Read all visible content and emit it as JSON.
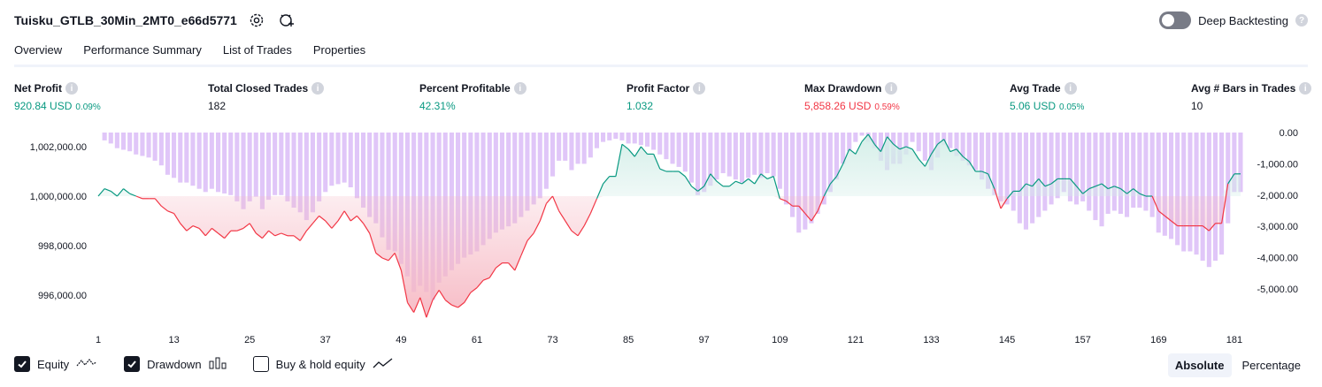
{
  "header": {
    "title": "Tuisku_GTLB_30Min_2MT0_e66d5771",
    "icons": [
      "settings-gear-icon",
      "add-to-chart-icon"
    ],
    "deep_backtesting_label": "Deep Backtesting",
    "deep_backtesting_on": false,
    "help_icon": "?"
  },
  "tabs": [
    {
      "label": "Overview",
      "active": true
    },
    {
      "label": "Performance Summary",
      "active": false
    },
    {
      "label": "List of Trades",
      "active": false
    },
    {
      "label": "Properties",
      "active": false
    }
  ],
  "metrics": [
    {
      "label": "Net Profit",
      "value": "920.84 USD",
      "pct": "0.09%",
      "color": "#089981"
    },
    {
      "label": "Total Closed Trades",
      "value": "182",
      "pct": "",
      "color": "#131722"
    },
    {
      "label": "Percent Profitable",
      "value": "42.31%",
      "pct": "",
      "color": "#089981"
    },
    {
      "label": "Profit Factor",
      "value": "1.032",
      "pct": "",
      "color": "#089981"
    },
    {
      "label": "Max Drawdown",
      "value": "5,858.26 USD",
      "pct": "0.59%",
      "color": "#f23645"
    },
    {
      "label": "Avg Trade",
      "value": "5.06 USD",
      "pct": "0.05%",
      "color": "#089981"
    },
    {
      "label": "Avg # Bars in Trades",
      "value": "10",
      "pct": "",
      "color": "#131722"
    }
  ],
  "info_glyph": "i",
  "chart_data": {
    "type": "line",
    "left_axis_ticks": [
      "1,002,000.00",
      "1,000,000.00",
      "998,000.00",
      "996,000.00"
    ],
    "left_axis_values": [
      1002000,
      1000000,
      998000,
      996000
    ],
    "right_axis_ticks": [
      "0.00",
      "-1,000.00",
      "-2,000.00",
      "-3,000.00",
      "-4,000.00",
      "-5,000.00"
    ],
    "right_axis_values": [
      0,
      -1000,
      -2000,
      -3000,
      -4000,
      -5000
    ],
    "x_ticks": [
      "1",
      "13",
      "25",
      "37",
      "49",
      "61",
      "73",
      "85",
      "97",
      "109",
      "121",
      "133",
      "145",
      "157",
      "169",
      "181"
    ],
    "initial_capital": 1000000,
    "equity_series": [
      [
        1,
        1000000
      ],
      [
        2,
        1000300
      ],
      [
        3,
        1000200
      ],
      [
        4,
        1000000
      ],
      [
        5,
        1000300
      ],
      [
        6,
        1000100
      ],
      [
        7,
        1000000
      ],
      [
        8,
        999900
      ],
      [
        9,
        999900
      ],
      [
        10,
        999900
      ],
      [
        11,
        999600
      ],
      [
        12,
        999400
      ],
      [
        13,
        999300
      ],
      [
        14,
        998900
      ],
      [
        15,
        998600
      ],
      [
        16,
        998800
      ],
      [
        17,
        998700
      ],
      [
        18,
        998400
      ],
      [
        19,
        998700
      ],
      [
        20,
        998500
      ],
      [
        21,
        998300
      ],
      [
        22,
        998600
      ],
      [
        23,
        998600
      ],
      [
        24,
        998700
      ],
      [
        25,
        998900
      ],
      [
        26,
        998500
      ],
      [
        27,
        998300
      ],
      [
        28,
        998600
      ],
      [
        29,
        998400
      ],
      [
        30,
        998500
      ],
      [
        31,
        998400
      ],
      [
        32,
        998400
      ],
      [
        33,
        998200
      ],
      [
        34,
        998600
      ],
      [
        35,
        998900
      ],
      [
        36,
        999200
      ],
      [
        37,
        999000
      ],
      [
        38,
        998700
      ],
      [
        39,
        999000
      ],
      [
        40,
        999400
      ],
      [
        41,
        999000
      ],
      [
        42,
        999200
      ],
      [
        43,
        998900
      ],
      [
        44,
        998500
      ],
      [
        45,
        997700
      ],
      [
        46,
        997500
      ],
      [
        47,
        997400
      ],
      [
        48,
        997700
      ],
      [
        49,
        997000
      ],
      [
        50,
        995700
      ],
      [
        51,
        995300
      ],
      [
        52,
        995900
      ],
      [
        53,
        995100
      ],
      [
        54,
        995800
      ],
      [
        55,
        996200
      ],
      [
        56,
        995800
      ],
      [
        57,
        995600
      ],
      [
        58,
        995500
      ],
      [
        59,
        995700
      ],
      [
        60,
        996100
      ],
      [
        61,
        996300
      ],
      [
        62,
        996600
      ],
      [
        63,
        996700
      ],
      [
        64,
        997100
      ],
      [
        65,
        997300
      ],
      [
        66,
        997300
      ],
      [
        67,
        997000
      ],
      [
        68,
        997600
      ],
      [
        69,
        998200
      ],
      [
        70,
        998500
      ],
      [
        71,
        999000
      ],
      [
        72,
        999700
      ],
      [
        73,
        1000000
      ],
      [
        74,
        999400
      ],
      [
        75,
        999000
      ],
      [
        76,
        998600
      ],
      [
        77,
        998400
      ],
      [
        78,
        998800
      ],
      [
        79,
        999300
      ],
      [
        80,
        999900
      ],
      [
        81,
        1000500
      ],
      [
        82,
        1000800
      ],
      [
        83,
        1000800
      ],
      [
        84,
        1002100
      ],
      [
        85,
        1001900
      ],
      [
        86,
        1001600
      ],
      [
        87,
        1002000
      ],
      [
        88,
        1001700
      ],
      [
        89,
        1001700
      ],
      [
        90,
        1001100
      ],
      [
        91,
        1001000
      ],
      [
        92,
        1001000
      ],
      [
        93,
        1001000
      ],
      [
        94,
        1000800
      ],
      [
        95,
        1000400
      ],
      [
        96,
        1000200
      ],
      [
        97,
        1000400
      ],
      [
        98,
        1000900
      ],
      [
        99,
        1000600
      ],
      [
        100,
        1000400
      ],
      [
        101,
        1000400
      ],
      [
        102,
        1000600
      ],
      [
        103,
        1000500
      ],
      [
        104,
        1000700
      ],
      [
        105,
        1000500
      ],
      [
        106,
        1000900
      ],
      [
        107,
        1000700
      ],
      [
        108,
        1000800
      ],
      [
        109,
        999900
      ],
      [
        110,
        999800
      ],
      [
        111,
        999600
      ],
      [
        112,
        999600
      ],
      [
        113,
        999300
      ],
      [
        114,
        999000
      ],
      [
        115,
        999400
      ],
      [
        116,
        1000000
      ],
      [
        117,
        1000500
      ],
      [
        118,
        1000800
      ],
      [
        119,
        1001300
      ],
      [
        120,
        1001900
      ],
      [
        121,
        1001700
      ],
      [
        122,
        1002200
      ],
      [
        123,
        1002500
      ],
      [
        124,
        1002100
      ],
      [
        125,
        1001800
      ],
      [
        126,
        1002400
      ],
      [
        127,
        1002100
      ],
      [
        128,
        1001900
      ],
      [
        129,
        1002000
      ],
      [
        130,
        1001900
      ],
      [
        131,
        1001500
      ],
      [
        132,
        1001200
      ],
      [
        133,
        1001700
      ],
      [
        134,
        1002100
      ],
      [
        135,
        1002300
      ],
      [
        136,
        1001800
      ],
      [
        137,
        1001900
      ],
      [
        138,
        1001600
      ],
      [
        139,
        1001400
      ],
      [
        140,
        1001000
      ],
      [
        141,
        1001000
      ],
      [
        142,
        1000900
      ],
      [
        143,
        1000300
      ],
      [
        144,
        999500
      ],
      [
        145,
        999900
      ],
      [
        146,
        1000200
      ],
      [
        147,
        1000200
      ],
      [
        148,
        1000500
      ],
      [
        149,
        1000400
      ],
      [
        150,
        1000700
      ],
      [
        151,
        1000400
      ],
      [
        152,
        1000500
      ],
      [
        153,
        1000700
      ],
      [
        154,
        1000700
      ],
      [
        155,
        1000700
      ],
      [
        156,
        1000400
      ],
      [
        157,
        1000100
      ],
      [
        158,
        1000300
      ],
      [
        159,
        1000400
      ],
      [
        160,
        1000500
      ],
      [
        161,
        1000300
      ],
      [
        162,
        1000400
      ],
      [
        163,
        1000300
      ],
      [
        164,
        1000100
      ],
      [
        165,
        1000300
      ],
      [
        166,
        1000100
      ],
      [
        167,
        1000000
      ],
      [
        168,
        1000000
      ],
      [
        169,
        999400
      ],
      [
        170,
        999200
      ],
      [
        171,
        999000
      ],
      [
        172,
        998800
      ],
      [
        173,
        998800
      ],
      [
        174,
        998800
      ],
      [
        175,
        998800
      ],
      [
        176,
        998800
      ],
      [
        177,
        998600
      ],
      [
        178,
        998900
      ],
      [
        179,
        998900
      ],
      [
        180,
        1000500
      ],
      [
        181,
        1000900
      ],
      [
        182,
        1000900
      ]
    ],
    "drawdown_bars": [
      [
        1,
        0
      ],
      [
        2,
        -250
      ],
      [
        3,
        -350
      ],
      [
        4,
        -500
      ],
      [
        5,
        -550
      ],
      [
        6,
        -600
      ],
      [
        7,
        -700
      ],
      [
        8,
        -750
      ],
      [
        9,
        -800
      ],
      [
        10,
        -900
      ],
      [
        11,
        -1050
      ],
      [
        12,
        -1350
      ],
      [
        13,
        -1450
      ],
      [
        14,
        -1600
      ],
      [
        15,
        -1600
      ],
      [
        16,
        -1700
      ],
      [
        17,
        -1800
      ],
      [
        18,
        -1900
      ],
      [
        19,
        -1800
      ],
      [
        20,
        -1900
      ],
      [
        21,
        -1950
      ],
      [
        22,
        -2000
      ],
      [
        23,
        -2200
      ],
      [
        24,
        -2450
      ],
      [
        25,
        -2200
      ],
      [
        26,
        -2050
      ],
      [
        27,
        -2450
      ],
      [
        28,
        -2150
      ],
      [
        29,
        -2000
      ],
      [
        30,
        -2000
      ],
      [
        31,
        -2200
      ],
      [
        32,
        -2400
      ],
      [
        33,
        -2550
      ],
      [
        34,
        -2800
      ],
      [
        35,
        -2550
      ],
      [
        36,
        -2200
      ],
      [
        37,
        -1900
      ],
      [
        38,
        -1700
      ],
      [
        39,
        -1650
      ],
      [
        40,
        -1600
      ],
      [
        41,
        -1750
      ],
      [
        42,
        -2100
      ],
      [
        43,
        -2400
      ],
      [
        44,
        -2700
      ],
      [
        45,
        -2900
      ],
      [
        46,
        -3350
      ],
      [
        47,
        -3750
      ],
      [
        48,
        -3800
      ],
      [
        49,
        -4200
      ],
      [
        50,
        -4600
      ],
      [
        51,
        -5100
      ],
      [
        52,
        -4900
      ],
      [
        53,
        -5100
      ],
      [
        54,
        -5350
      ],
      [
        55,
        -4800
      ],
      [
        56,
        -4600
      ],
      [
        57,
        -4400
      ],
      [
        58,
        -4200
      ],
      [
        59,
        -4000
      ],
      [
        60,
        -3900
      ],
      [
        61,
        -3800
      ],
      [
        62,
        -3600
      ],
      [
        63,
        -3400
      ],
      [
        64,
        -3200
      ],
      [
        65,
        -3100
      ],
      [
        66,
        -3000
      ],
      [
        67,
        -2900
      ],
      [
        68,
        -2700
      ],
      [
        69,
        -2500
      ],
      [
        70,
        -2300
      ],
      [
        71,
        -2100
      ],
      [
        72,
        -1800
      ],
      [
        73,
        -1400
      ],
      [
        74,
        -900
      ],
      [
        75,
        -900
      ],
      [
        76,
        -1200
      ],
      [
        77,
        -1000
      ],
      [
        78,
        -1000
      ],
      [
        79,
        -800
      ],
      [
        80,
        -500
      ],
      [
        81,
        -300
      ],
      [
        82,
        -250
      ],
      [
        83,
        -200
      ],
      [
        84,
        -250
      ],
      [
        85,
        -350
      ],
      [
        86,
        -350
      ],
      [
        87,
        -400
      ],
      [
        88,
        -450
      ],
      [
        89,
        -550
      ],
      [
        90,
        -700
      ],
      [
        91,
        -850
      ],
      [
        92,
        -1000
      ],
      [
        93,
        -1100
      ],
      [
        94,
        -1250
      ],
      [
        95,
        -1600
      ],
      [
        96,
        -2000
      ],
      [
        97,
        -1900
      ],
      [
        98,
        -1700
      ],
      [
        99,
        -1500
      ],
      [
        100,
        -1300
      ],
      [
        101,
        -1400
      ],
      [
        102,
        -1500
      ],
      [
        103,
        -1600
      ],
      [
        104,
        -1450
      ],
      [
        105,
        -1350
      ],
      [
        106,
        -1450
      ],
      [
        107,
        -1300
      ],
      [
        108,
        -1400
      ],
      [
        109,
        -1800
      ],
      [
        110,
        -2300
      ],
      [
        111,
        -2700
      ],
      [
        112,
        -3200
      ],
      [
        113,
        -3100
      ],
      [
        114,
        -2900
      ],
      [
        115,
        -2600
      ],
      [
        116,
        -2300
      ],
      [
        117,
        -1900
      ],
      [
        118,
        -1500
      ],
      [
        119,
        -1000
      ],
      [
        120,
        -600
      ],
      [
        121,
        -300
      ],
      [
        122,
        -100
      ],
      [
        123,
        -300
      ],
      [
        124,
        -500
      ],
      [
        125,
        -900
      ],
      [
        126,
        -1200
      ],
      [
        127,
        -1000
      ],
      [
        128,
        -1000
      ],
      [
        129,
        -700
      ],
      [
        130,
        -300
      ],
      [
        131,
        -600
      ],
      [
        132,
        -900
      ],
      [
        133,
        -1200
      ],
      [
        134,
        -800
      ],
      [
        135,
        -400
      ],
      [
        136,
        -500
      ],
      [
        137,
        -750
      ],
      [
        138,
        -900
      ],
      [
        139,
        -1050
      ],
      [
        140,
        -1200
      ],
      [
        141,
        -1500
      ],
      [
        142,
        -1800
      ],
      [
        143,
        -2000
      ],
      [
        144,
        -2200
      ],
      [
        145,
        -2300
      ],
      [
        146,
        -2500
      ],
      [
        147,
        -2900
      ],
      [
        148,
        -3100
      ],
      [
        149,
        -2900
      ],
      [
        150,
        -2700
      ],
      [
        151,
        -2500
      ],
      [
        152,
        -2300
      ],
      [
        153,
        -2100
      ],
      [
        154,
        -1900
      ],
      [
        155,
        -2200
      ],
      [
        156,
        -2300
      ],
      [
        157,
        -2200
      ],
      [
        158,
        -2500
      ],
      [
        159,
        -2800
      ],
      [
        160,
        -3000
      ],
      [
        161,
        -2600
      ],
      [
        162,
        -2500
      ],
      [
        163,
        -2600
      ],
      [
        164,
        -2700
      ],
      [
        165,
        -2400
      ],
      [
        166,
        -2400
      ],
      [
        167,
        -2500
      ],
      [
        168,
        -2700
      ],
      [
        169,
        -3200
      ],
      [
        170,
        -3300
      ],
      [
        171,
        -3400
      ],
      [
        172,
        -3600
      ],
      [
        173,
        -3800
      ],
      [
        174,
        -3800
      ],
      [
        175,
        -3900
      ],
      [
        176,
        -4100
      ],
      [
        177,
        -4300
      ],
      [
        178,
        -4100
      ],
      [
        179,
        -3900
      ],
      [
        180,
        -2900
      ],
      [
        181,
        -1900
      ],
      [
        182,
        -1900
      ]
    ],
    "colors": {
      "equity_up": "#089981",
      "equity_down": "#f23645",
      "fill_up": "#d3eee8",
      "fill_down": "#f6b8c3",
      "drawdown_bar": "#dbbcf7"
    }
  },
  "legend": [
    {
      "label": "Equity",
      "checked": true,
      "icon": "equity-line-icon"
    },
    {
      "label": "Drawdown",
      "checked": true,
      "icon": "drawdown-bars-icon"
    },
    {
      "label": "Buy & hold equity",
      "checked": false,
      "icon": "buy-hold-line-icon"
    }
  ],
  "modes": [
    {
      "label": "Absolute",
      "active": true
    },
    {
      "label": "Percentage",
      "active": false
    }
  ]
}
